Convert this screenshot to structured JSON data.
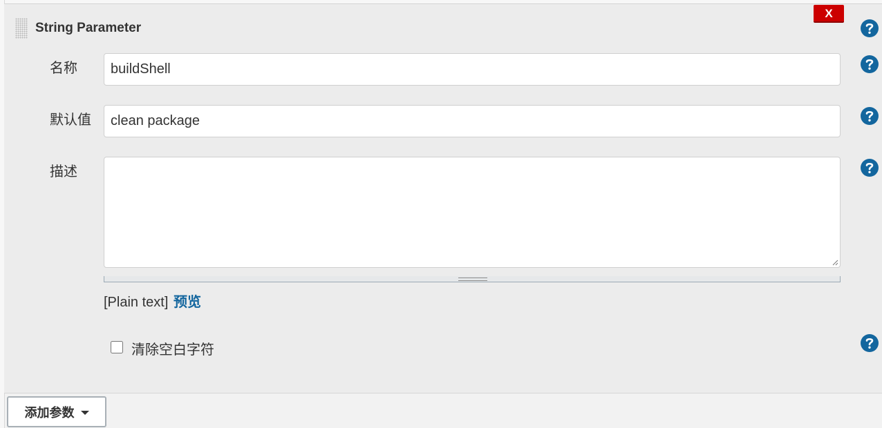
{
  "parameter": {
    "title": "String Parameter",
    "delete_label": "X",
    "fields": {
      "name": {
        "label": "名称",
        "value": "buildShell"
      },
      "default_value": {
        "label": "默认值",
        "value": "clean package"
      },
      "description": {
        "label": "描述",
        "value": ""
      }
    },
    "syntax": {
      "mode_text": "[Plain text]",
      "preview_label": "预览"
    },
    "trim": {
      "label": "清除空白字符",
      "checked": false
    }
  },
  "footer": {
    "add_param_label": "添加参数"
  },
  "icons": {
    "help": "help-icon",
    "drag": "drag-handle-icon",
    "dropdown": "caret-down-icon",
    "resize": "resize-grip-icon"
  },
  "colors": {
    "help_icon": "#13669e",
    "delete_button": "#cc0000",
    "link": "#13669e",
    "panel_background": "#ececec"
  }
}
